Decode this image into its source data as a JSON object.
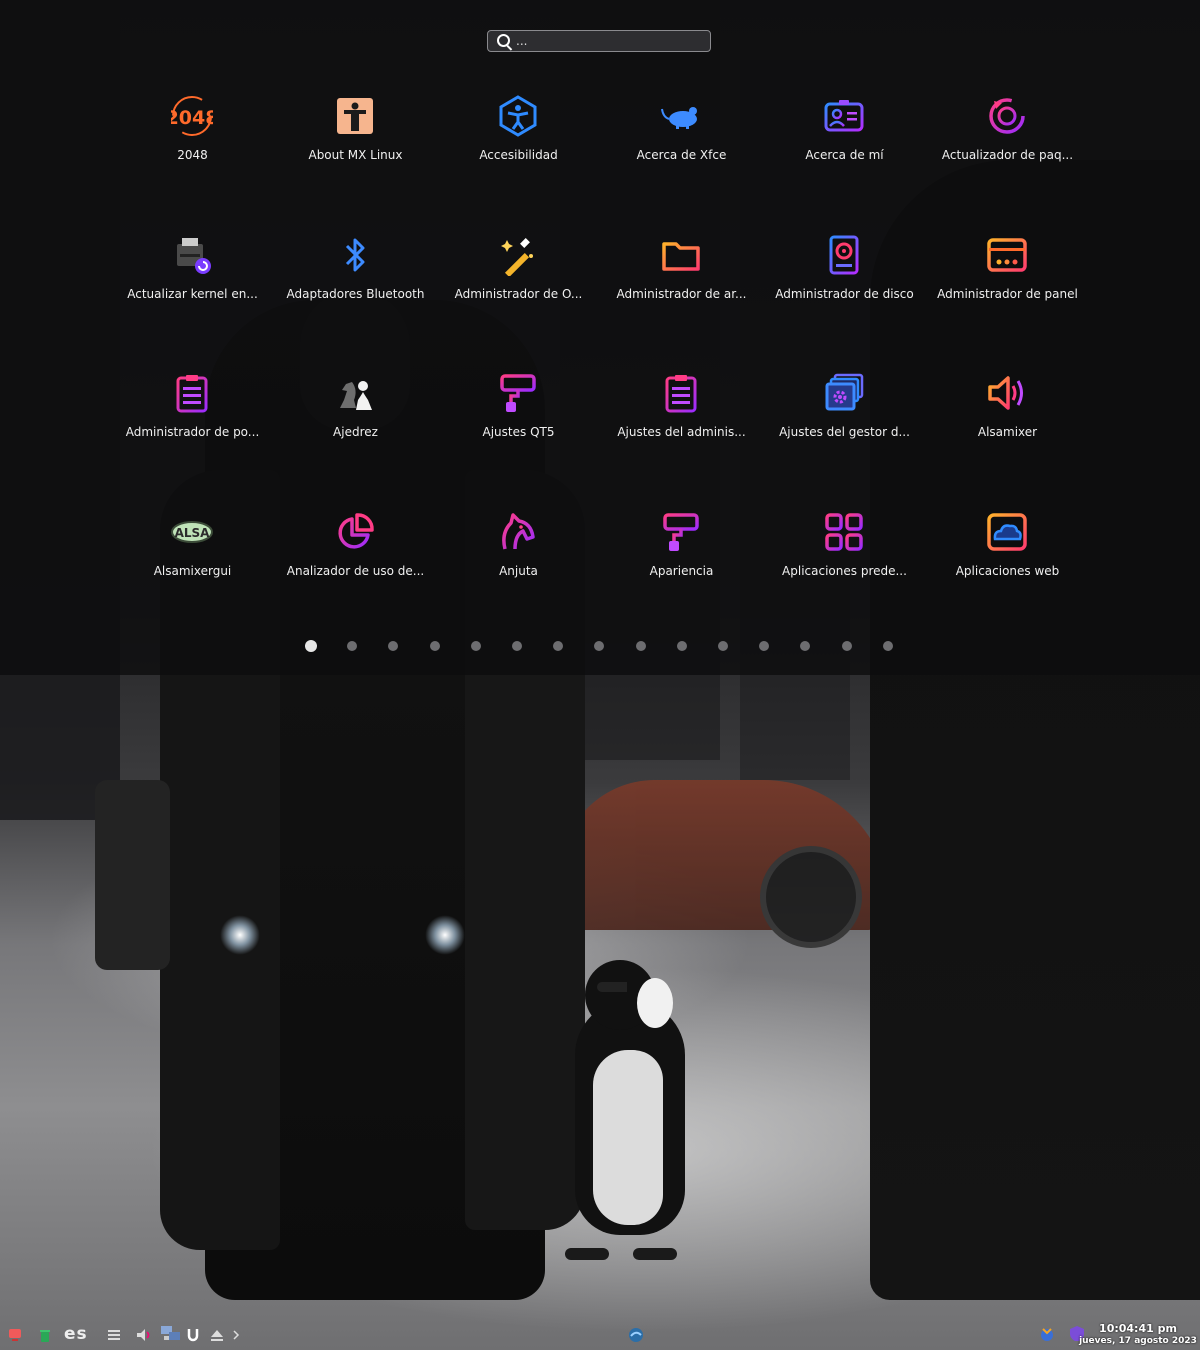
{
  "search": {
    "placeholder": "..."
  },
  "apps": [
    {
      "label": "2048",
      "icon": "game-2048-icon"
    },
    {
      "label": "About MX Linux",
      "icon": "about-mx-icon"
    },
    {
      "label": "Accesibilidad",
      "icon": "accessibility-icon"
    },
    {
      "label": "Acerca de Xfce",
      "icon": "xfce-mouse-icon"
    },
    {
      "label": "Acerca de mí",
      "icon": "contact-card-icon"
    },
    {
      "label": "Actualizador de paq...",
      "icon": "updater-icon"
    },
    {
      "label": "Actualizar kernel en...",
      "icon": "kernel-update-icon"
    },
    {
      "label": "Adaptadores Bluetooth",
      "icon": "bluetooth-icon"
    },
    {
      "label": "Administrador de O...",
      "icon": "magic-wand-icon"
    },
    {
      "label": "Administrador de ar...",
      "icon": "folder-icon"
    },
    {
      "label": "Administrador de disco",
      "icon": "disk-icon"
    },
    {
      "label": "Administrador de panel",
      "icon": "panel-icon"
    },
    {
      "label": "Administrador de po...",
      "icon": "clipboard-icon"
    },
    {
      "label": "Ajedrez",
      "icon": "chess-icon"
    },
    {
      "label": "Ajustes QT5",
      "icon": "paint-roller-icon"
    },
    {
      "label": "Ajustes del adminis...",
      "icon": "clipboard-icon"
    },
    {
      "label": "Ajustes del gestor d...",
      "icon": "window-settings-icon"
    },
    {
      "label": "Alsamixer",
      "icon": "speaker-icon"
    },
    {
      "label": "Alsamixergui",
      "icon": "alsa-icon"
    },
    {
      "label": "Analizador de uso de...",
      "icon": "pie-chart-icon"
    },
    {
      "label": "Anjuta",
      "icon": "horse-icon"
    },
    {
      "label": "Apariencia",
      "icon": "paint-roller-icon"
    },
    {
      "label": "Aplicaciones prede...",
      "icon": "grid-icon"
    },
    {
      "label": "Aplicaciones web",
      "icon": "cloud-window-icon"
    }
  ],
  "pagination": {
    "pages": 15,
    "current": 1
  },
  "panel": {
    "keyboard_layout": "es",
    "clock_time": "10:04:41 pm",
    "clock_date": "jueves, 17 agosto 2023"
  },
  "colors": {
    "accent_orange": "#ff6a2b",
    "accent_pink": "#ff2f86",
    "accent_violet": "#a335ff",
    "accent_blue": "#2f8bff"
  }
}
